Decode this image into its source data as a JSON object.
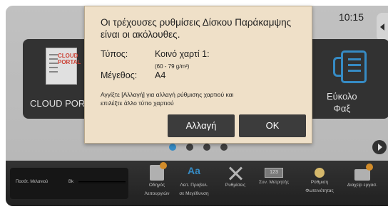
{
  "status": {
    "time": "10:15"
  },
  "tiles": {
    "cloud_portal": {
      "label": "CLOUD PORTAL",
      "brand_line1": "CLOUD",
      "brand_line2": "PORTAL"
    },
    "easy_fax": {
      "label_line1": "Εύκολο",
      "label_line2": "Φαξ"
    }
  },
  "pagination": {
    "count": 4,
    "active": 0
  },
  "taskbar": {
    "toner_label": "Ποσότ. Μελανιού",
    "toner_channel": "Bk",
    "items": [
      {
        "line1": "Οδηγός",
        "line2": "Λειτουργιών"
      },
      {
        "line1": "Λειτ. Προβολ.",
        "line2": "σε Μεγέθυνση",
        "icon_text": "Aa"
      },
      {
        "line1": "Ρυθμίσεις",
        "line2": ""
      },
      {
        "line1": "Συν. Μετρητής",
        "line2": "",
        "icon_text": "123"
      },
      {
        "line1": "Ρύθμιση",
        "line2": "Φωτεινότητας"
      },
      {
        "line1": "Διαχείρ εργασ.",
        "line2": ""
      }
    ]
  },
  "dialog": {
    "message": "Οι τρέχουσες ρυθμίσεις Δίσκου Παράκαμψης είναι οι ακόλουθες.",
    "type_label": "Τύπος:",
    "type_value": "Κοινό χαρτί 1:",
    "type_range": "(60 - 79 g/m²)",
    "size_label": "Μέγεθος:",
    "size_value": "A4",
    "note": "Αγγίξτε [Αλλαγή] για αλλαγή ρύθμισης χαρτιού και επιλέξτε άλλο τύπο χαρτιού",
    "change_button": "Αλλαγή",
    "ok_button": "OK"
  }
}
